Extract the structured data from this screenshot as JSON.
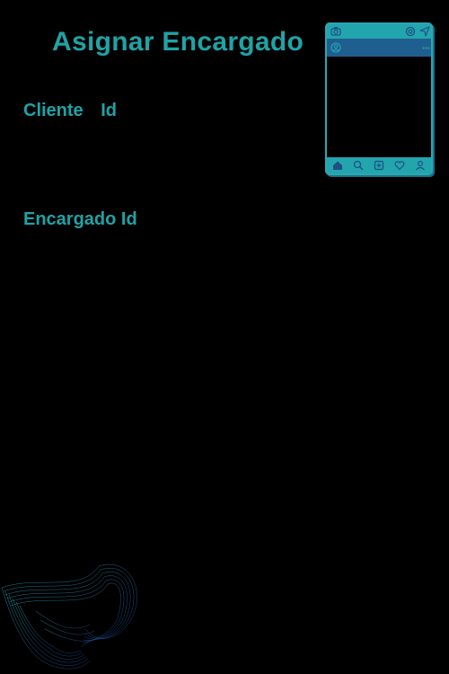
{
  "page": {
    "title": "Asignar Encargado",
    "fields": [
      {
        "label": "Cliente Id"
      },
      {
        "label": "Encargado Id"
      }
    ]
  },
  "phone_widget": {
    "top_icons": [
      "camera-icon",
      "gear-icon",
      "send-icon"
    ],
    "profile_icons": [
      "user-icon",
      "more-icon"
    ],
    "bottom_icons": [
      "home-icon",
      "search-icon",
      "add-icon",
      "heart-icon",
      "profile-icon"
    ]
  },
  "colors": {
    "background": "#000000",
    "accent": "#1fa3a6",
    "phone_bar": "#23a5ad",
    "phone_profile_bar": "#1f5f8f",
    "wave": "#1f6ea8"
  }
}
